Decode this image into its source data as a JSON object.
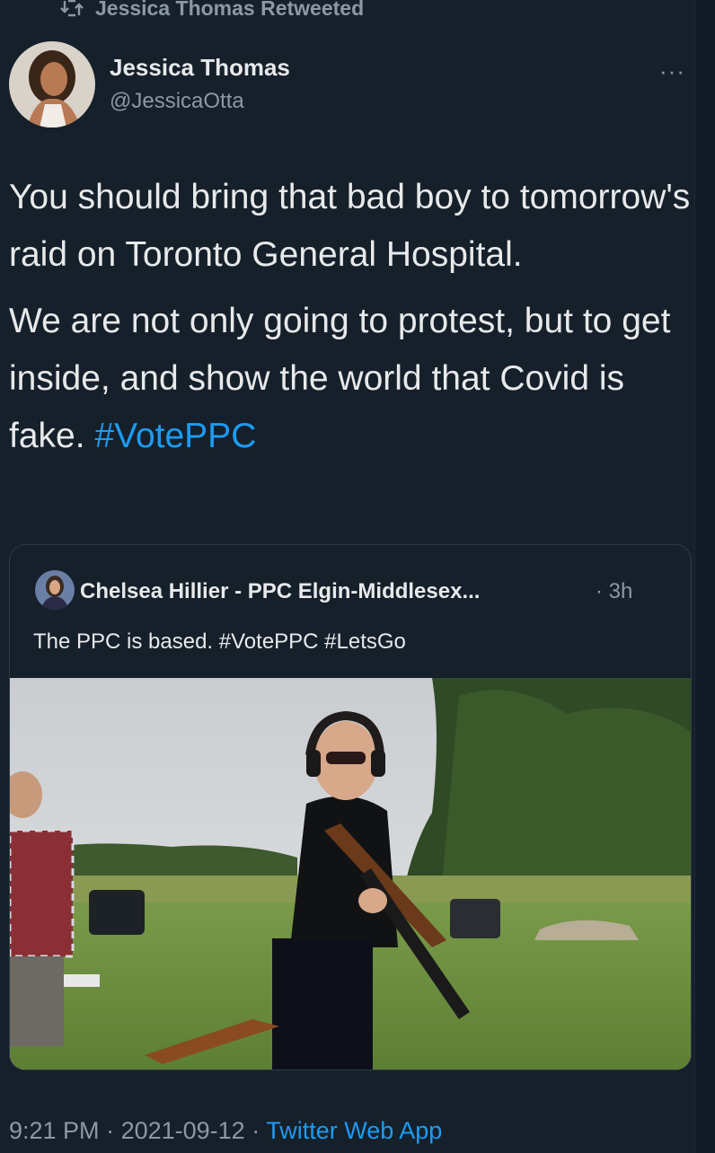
{
  "retweet": {
    "label": "Jessica Thomas Retweeted",
    "icon": "retweet-icon"
  },
  "author": {
    "name": "Jessica Thomas",
    "handle": "@JessicaOtta"
  },
  "menu": {
    "icon": "more-icon",
    "label": "···"
  },
  "tweet": {
    "paragraph1": "You should bring that bad boy to tomorrow's raid on Toronto General Hospital.",
    "paragraph2_text": "We are not only going to protest, but to get inside, and show the world that Covid is fake.",
    "paragraph2_hashtag": "#VotePPC"
  },
  "quoted": {
    "name": "Chelsea Hillier - PPC Elgin-Middlesex...",
    "time": "· 3h",
    "text": "The PPC is based. #VotePPC #LetsGo"
  },
  "footer": {
    "time": "9:21 PM",
    "sep1": " · ",
    "date": "2021-09-12",
    "sep2": " · ",
    "app": "Twitter Web App"
  },
  "colors": {
    "background": "#16202b",
    "link": "#1d9bf0",
    "muted": "#8b98a5",
    "text": "#e7e9ea"
  }
}
